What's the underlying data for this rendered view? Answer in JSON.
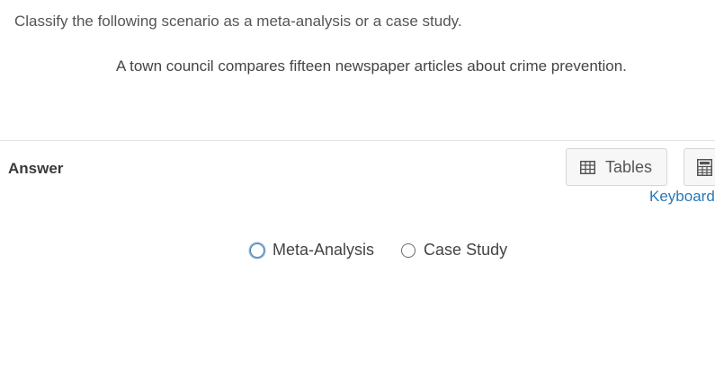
{
  "question": {
    "prompt": "Classify the following scenario as a meta-analysis or a case study.",
    "scenario": "A town council compares fifteen newspaper articles about crime prevention."
  },
  "answer": {
    "label": "Answer",
    "options": [
      {
        "label": "Meta-Analysis",
        "selected": false,
        "focused": true
      },
      {
        "label": "Case Study",
        "selected": false,
        "focused": false
      }
    ]
  },
  "tools": {
    "tables_label": "Tables",
    "tables_icon": "table-icon",
    "calculator_icon": "calculator-icon",
    "keyboard_link": "Keyboard"
  },
  "colors": {
    "link": "#2a78b8",
    "focus_ring": "#4a7fb5"
  }
}
